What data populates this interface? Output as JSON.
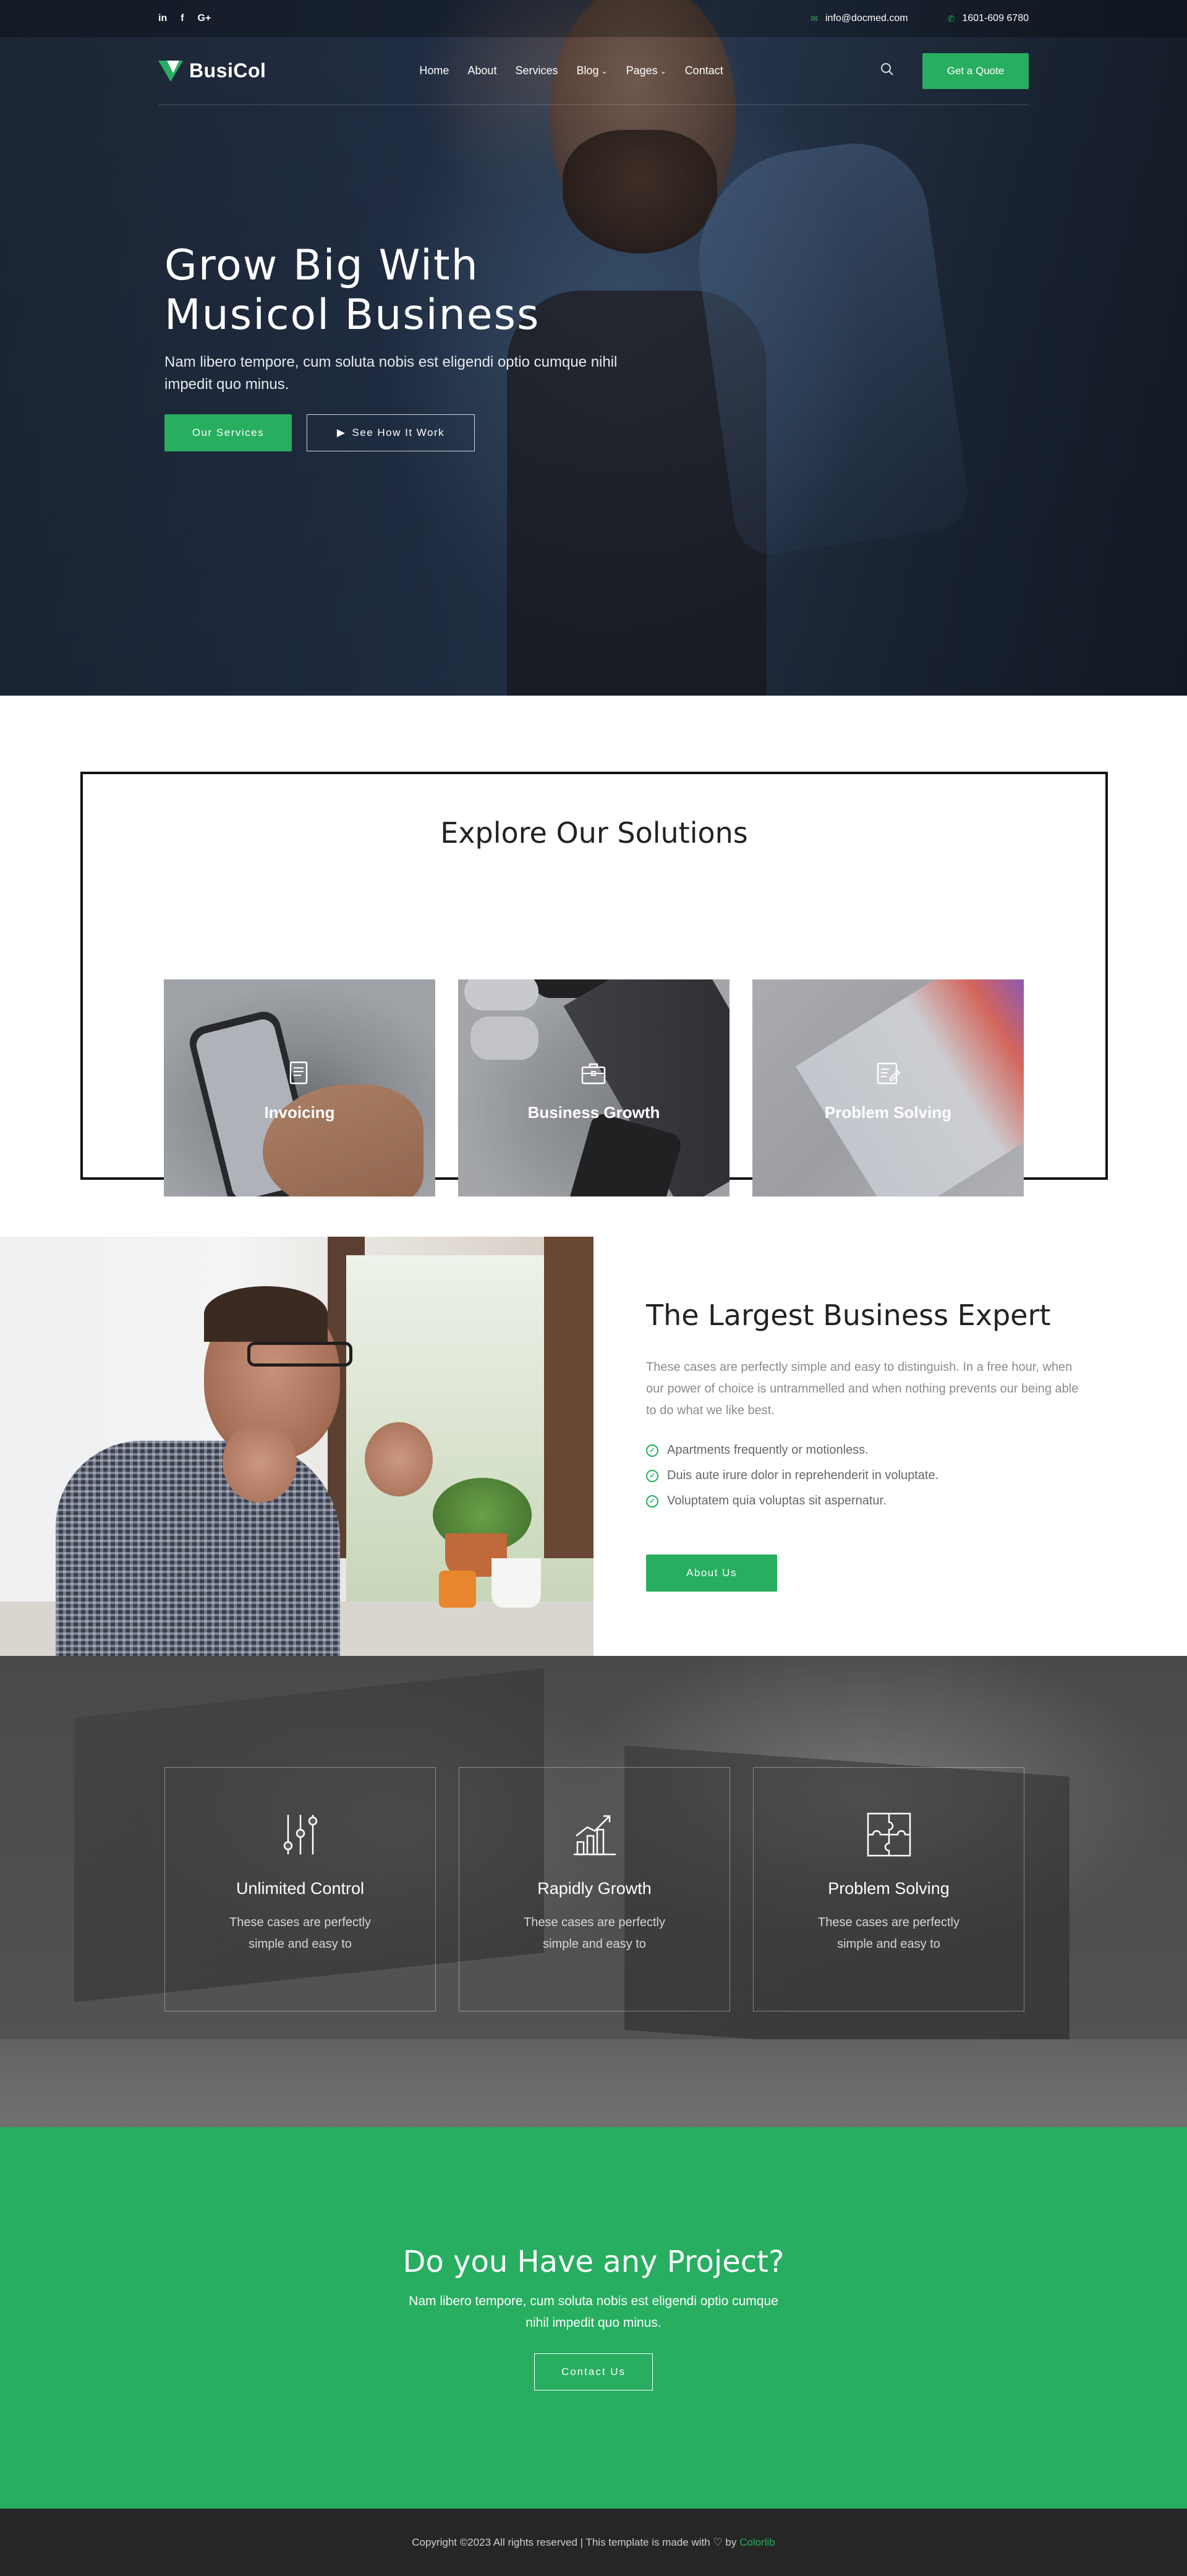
{
  "topbar": {
    "social": [
      "in",
      "f",
      "G+"
    ],
    "email": "info@docmed.com",
    "phone": "1601-609 6780"
  },
  "nav": {
    "logo": "BusiCol",
    "items": [
      {
        "label": "Home"
      },
      {
        "label": "About"
      },
      {
        "label": "Services"
      },
      {
        "label": "Blog",
        "dropdown": true
      },
      {
        "label": "Pages",
        "dropdown": true
      },
      {
        "label": "Contact"
      }
    ],
    "cta": "Get a Quote"
  },
  "hero": {
    "title_line1": "Grow Big With",
    "title_line2": "Musicol Business",
    "subtitle": "Nam libero tempore, cum soluta nobis est eligendi optio cumque nihil impedit quo minus.",
    "primary_btn": "Our Services",
    "secondary_btn": "See How It Work"
  },
  "solutions": {
    "title": "Explore Our Solutions",
    "cards": [
      {
        "label": "Invoicing",
        "icon": "document-icon"
      },
      {
        "label": "Business Growth",
        "icon": "briefcase-icon"
      },
      {
        "label": "Problem Solving",
        "icon": "clipboard-edit-icon"
      }
    ]
  },
  "about": {
    "title": "The Largest Business Expert",
    "text": "These cases are perfectly simple and easy to distinguish. In a free hour, when our power of choice is untrammelled and when nothing prevents our being able to do what we like best.",
    "checks": [
      "Apartments frequently or motionless.",
      "Duis aute irure dolor in reprehenderit in voluptate.",
      "Voluptatem quia voluptas sit aspernatur."
    ],
    "button": "About Us"
  },
  "features": [
    {
      "title": "Unlimited Control",
      "text": "These cases are perfectly simple and easy to",
      "icon": "sliders-icon"
    },
    {
      "title": "Rapidly Growth",
      "text": "These cases are perfectly simple and easy to",
      "icon": "growth-chart-icon"
    },
    {
      "title": "Problem Solving",
      "text": "These cases are perfectly simple and easy to",
      "icon": "puzzle-icon"
    }
  ],
  "cta": {
    "title": "Do you Have any Project?",
    "text": "Nam libero tempore, cum soluta nobis est eligendi optio cumque nihil impedit quo minus.",
    "button": "Contact Us"
  },
  "footer": {
    "text": "Copyright ©2023 All rights reserved | This template is made with ♡ by",
    "brand": "Colorlib"
  },
  "colors": {
    "accent": "#27ae60",
    "footer_bg": "#262626"
  }
}
